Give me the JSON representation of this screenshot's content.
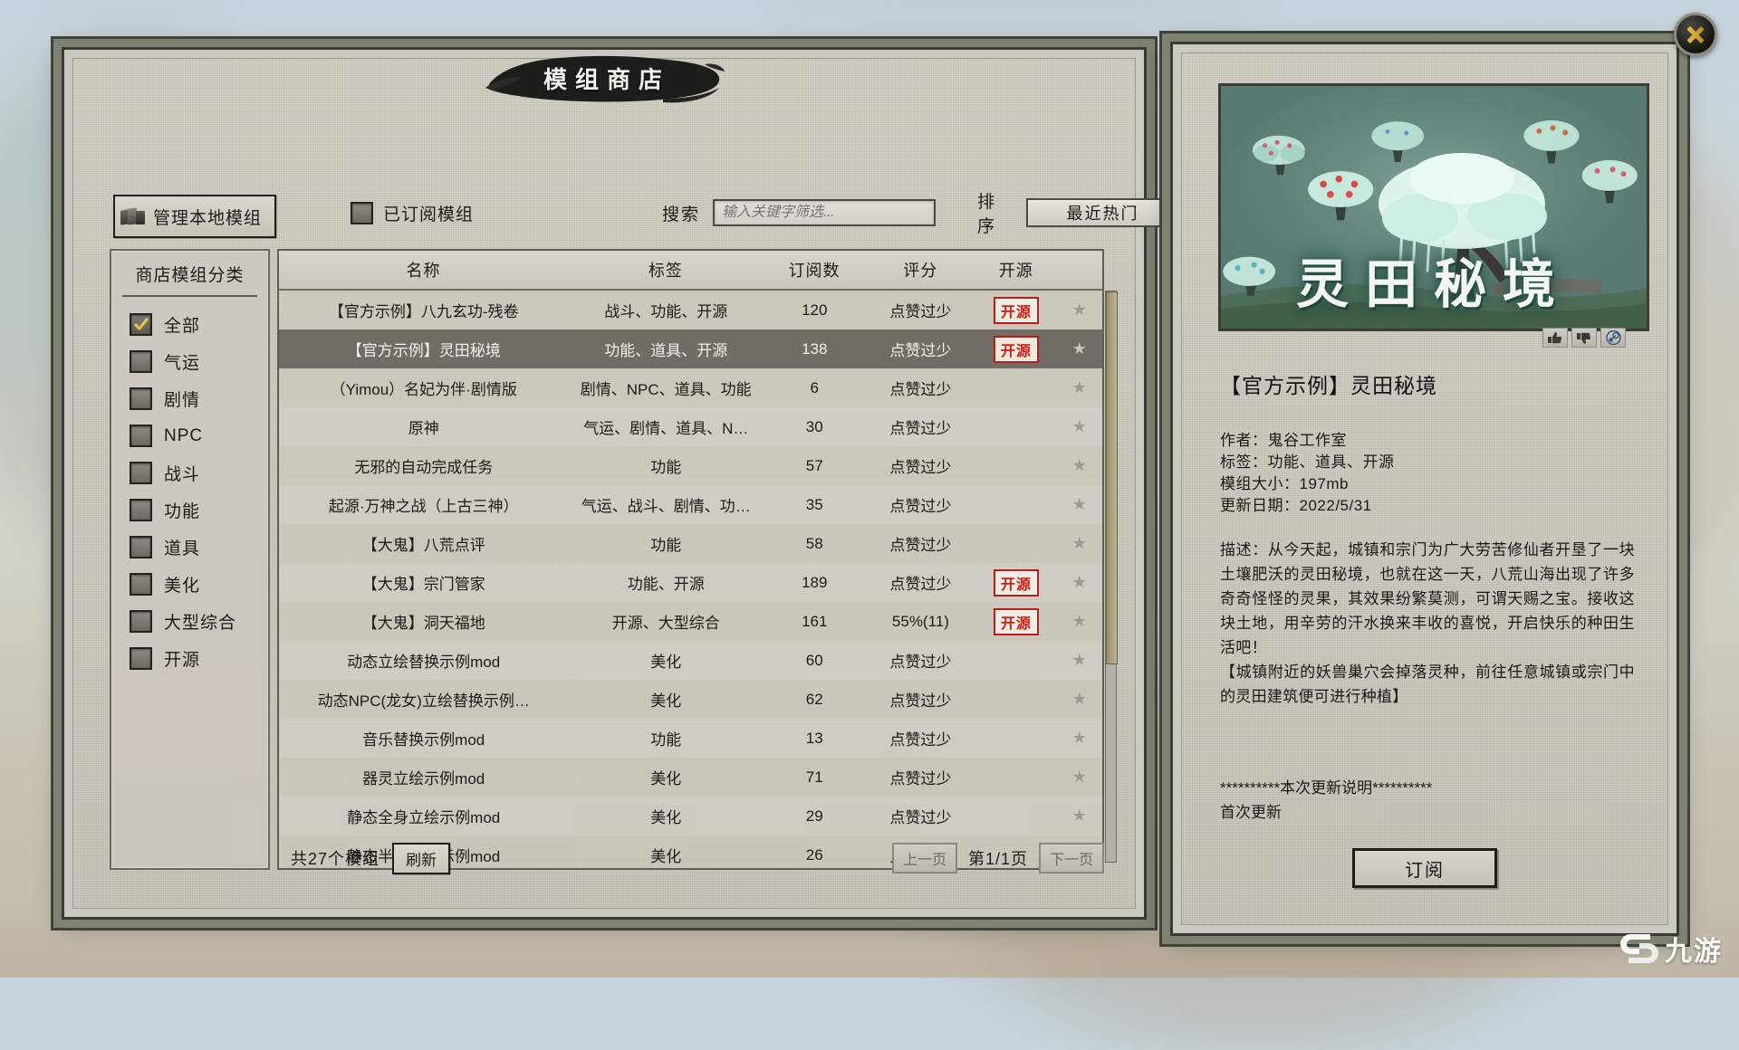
{
  "window": {
    "title": "模组商店",
    "close_icon": "close-icon"
  },
  "toolbar": {
    "manage_local_label": "管理本地模组",
    "manage_local_icon": "books-icon",
    "subscribed_label": "已订阅模组",
    "subscribed_checked": false,
    "search_label": "搜索",
    "search_value": "",
    "search_placeholder": "输入关键字筛选...",
    "sort_label": "排序",
    "sort_value": "最近热门",
    "sort_arrow_icon": "triangle-left-icon"
  },
  "sidebar": {
    "title": "商店模组分类",
    "items": [
      {
        "label": "全部",
        "checked": true
      },
      {
        "label": "气运",
        "checked": false
      },
      {
        "label": "剧情",
        "checked": false
      },
      {
        "label": "NPC",
        "checked": false
      },
      {
        "label": "战斗",
        "checked": false
      },
      {
        "label": "功能",
        "checked": false
      },
      {
        "label": "道具",
        "checked": false
      },
      {
        "label": "美化",
        "checked": false
      },
      {
        "label": "大型综合",
        "checked": false
      },
      {
        "label": "开源",
        "checked": false
      }
    ]
  },
  "table": {
    "columns": [
      "名称",
      "标签",
      "订阅数",
      "评分",
      "开源"
    ],
    "open_source_badge": "开源",
    "star_icon": "star-icon",
    "rows": [
      {
        "name": "【官方示例】八九玄功-残卷",
        "tags": "战斗、功能、开源",
        "subs": "120",
        "rating": "点赞过少",
        "open": true,
        "selected": false
      },
      {
        "name": "【官方示例】灵田秘境",
        "tags": "功能、道具、开源",
        "subs": "138",
        "rating": "点赞过少",
        "open": true,
        "selected": true
      },
      {
        "name": "（Yimou）名妃为伴·剧情版",
        "tags": "剧情、NPC、道具、功能",
        "subs": "6",
        "rating": "点赞过少",
        "open": false,
        "selected": false
      },
      {
        "name": "原神",
        "tags": "气运、剧情、道具、N…",
        "subs": "30",
        "rating": "点赞过少",
        "open": false,
        "selected": false
      },
      {
        "name": "无邪的自动完成任务",
        "tags": "功能",
        "subs": "57",
        "rating": "点赞过少",
        "open": false,
        "selected": false
      },
      {
        "name": "起源·万神之战（上古三神）",
        "tags": "气运、战斗、剧情、功…",
        "subs": "35",
        "rating": "点赞过少",
        "open": false,
        "selected": false
      },
      {
        "name": "【大鬼】八荒点评",
        "tags": "功能",
        "subs": "58",
        "rating": "点赞过少",
        "open": false,
        "selected": false
      },
      {
        "name": "【大鬼】宗门管家",
        "tags": "功能、开源",
        "subs": "189",
        "rating": "点赞过少",
        "open": true,
        "selected": false
      },
      {
        "name": "【大鬼】洞天福地",
        "tags": "开源、大型综合",
        "subs": "161",
        "rating": "55%(11)",
        "open": true,
        "selected": false
      },
      {
        "name": "动态立绘替换示例mod",
        "tags": "美化",
        "subs": "60",
        "rating": "点赞过少",
        "open": false,
        "selected": false
      },
      {
        "name": "动态NPC(龙女)立绘替换示例…",
        "tags": "美化",
        "subs": "62",
        "rating": "点赞过少",
        "open": false,
        "selected": false
      },
      {
        "name": "音乐替换示例mod",
        "tags": "功能",
        "subs": "13",
        "rating": "点赞过少",
        "open": false,
        "selected": false
      },
      {
        "name": "器灵立绘示例mod",
        "tags": "美化",
        "subs": "71",
        "rating": "点赞过少",
        "open": false,
        "selected": false
      },
      {
        "name": "静态全身立绘示例mod",
        "tags": "美化",
        "subs": "29",
        "rating": "点赞过少",
        "open": false,
        "selected": false
      },
      {
        "name": "静态半身立绘示例mod",
        "tags": "美化",
        "subs": "26",
        "rating": "点赞过少",
        "open": false,
        "selected": false
      }
    ]
  },
  "footer": {
    "total_label": "共27个模组",
    "refresh_label": "刷新",
    "prev_label": "上一页",
    "page_label": "第1/1页",
    "next_label": "下一页"
  },
  "detail": {
    "preview_caption": "灵田秘境",
    "actions": [
      {
        "icon": "thumbs-up-icon"
      },
      {
        "icon": "thumbs-down-icon"
      },
      {
        "icon": "steam-icon"
      }
    ],
    "title": "【官方示例】灵田秘境",
    "author": "作者：鬼谷工作室",
    "tags": "标签：功能、道具、开源",
    "size": "模组大小：197mb",
    "updated": "更新日期：2022/5/31",
    "description": "描述：从今天起，城镇和宗门为广大劳苦修仙者开垦了一块土壤肥沃的灵田秘境，也就在这一天，八荒山海出现了许多奇奇怪怪的灵果，其效果纷繁莫测，可谓天赐之宝。接收这块土地，用辛劳的汗水换来丰收的喜悦，开启快乐的种田生活吧！\n【城镇附近的妖兽巢穴会掉落灵种，前往任意城镇或宗门中的灵田建筑便可进行种植】",
    "update_header": "**********本次更新说明**********",
    "update_body": "首次更新",
    "subscribe_label": "订阅"
  },
  "watermark": {
    "text": "九游"
  },
  "colors": {
    "accent_red": "#d81c12",
    "panel_bg": "#cdc9c0",
    "panel_border": "#3a3a36",
    "frame_green": "#7d8270",
    "selected_row": "#6f6d66",
    "check_gold": "#e8c24a"
  }
}
